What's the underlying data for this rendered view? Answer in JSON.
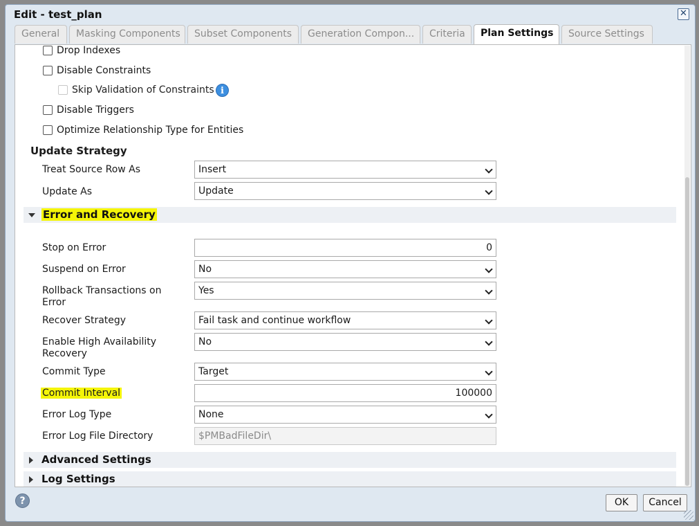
{
  "window": {
    "title": "Edit - test_plan"
  },
  "tabs": [
    {
      "label": "General"
    },
    {
      "label": "Masking Components"
    },
    {
      "label": "Subset Components"
    },
    {
      "label": "Generation Compon..."
    },
    {
      "label": "Criteria"
    },
    {
      "label": "Plan Settings",
      "active": true
    },
    {
      "label": "Source Settings"
    }
  ],
  "checkboxes": {
    "drop_indexes": {
      "label": "Drop Indexes",
      "checked": false
    },
    "disable_constraints": {
      "label": "Disable Constraints",
      "checked": false
    },
    "skip_validation": {
      "label": "Skip Validation of Constraints",
      "checked": false,
      "disabled": true
    },
    "disable_triggers": {
      "label": "Disable Triggers",
      "checked": false
    },
    "optimize_relationship": {
      "label": "Optimize Relationship Type for Entities",
      "checked": false
    }
  },
  "update_strategy": {
    "title": "Update Strategy",
    "treat_source_row_as": {
      "label": "Treat Source Row As",
      "value": "Insert"
    },
    "update_as": {
      "label": "Update As",
      "value": "Update"
    }
  },
  "error_recovery": {
    "title": "Error and Recovery",
    "stop_on_error": {
      "label": "Stop on Error",
      "value": "0"
    },
    "suspend_on_error": {
      "label": "Suspend on Error",
      "value": "No"
    },
    "rollback_transactions": {
      "label_line1": "Rollback Transactions on",
      "label_line2": "Error",
      "value": "Yes"
    },
    "recover_strategy": {
      "label": "Recover Strategy",
      "value": "Fail task and continue workflow"
    },
    "high_availability": {
      "label_line1": "Enable High Availability",
      "label_line2": "Recovery",
      "value": "No"
    },
    "commit_type": {
      "label": "Commit Type",
      "value": "Target"
    },
    "commit_interval": {
      "label": "Commit Interval",
      "value": "100000"
    },
    "error_log_type": {
      "label": "Error Log Type",
      "value": "None"
    },
    "error_log_dir": {
      "label": "Error Log File Directory",
      "value": "$PMBadFileDir\\"
    }
  },
  "sections": {
    "advanced": {
      "title": "Advanced Settings"
    },
    "log": {
      "title": "Log Settings"
    }
  },
  "footer": {
    "ok": "OK",
    "cancel": "Cancel",
    "help_glyph": "?"
  },
  "icons": {
    "close": "close-icon",
    "info": "info-icon",
    "help": "help-icon"
  },
  "colors": {
    "highlight": "#f5f508",
    "dialog_bg": "#dfe8f1",
    "info_blue": "#3d8fe0"
  }
}
